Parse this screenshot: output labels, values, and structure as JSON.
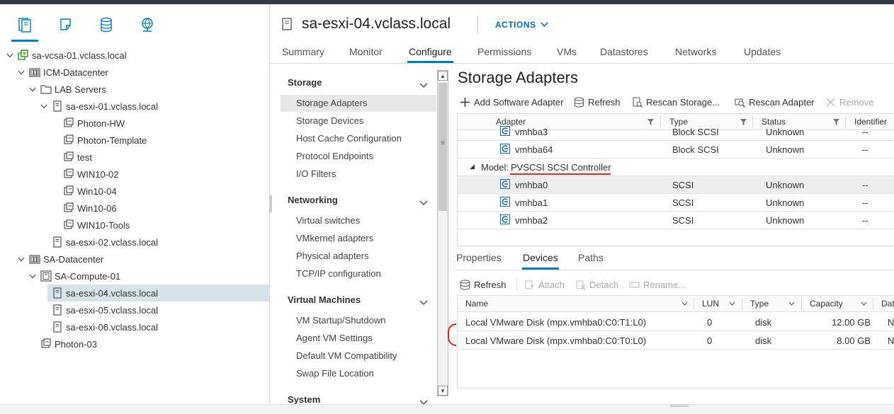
{
  "nav": {
    "icons": [
      "hosts-and-clusters-icon",
      "vms-and-templates-icon",
      "storage-icon",
      "networking-icon"
    ]
  },
  "tree": [
    {
      "label": "sa-vcsa-01.vclass.local",
      "type": "vcenter"
    },
    {
      "label": "ICM-Datacenter",
      "type": "datacenter"
    },
    {
      "label": "LAB Servers",
      "type": "folder"
    },
    {
      "label": "sa-esxi-01.vclass.local",
      "type": "host"
    },
    {
      "label": "Photon-HW",
      "type": "vm"
    },
    {
      "label": "Photon-Template",
      "type": "vm"
    },
    {
      "label": "test",
      "type": "vm"
    },
    {
      "label": "WIN10-02",
      "type": "vm"
    },
    {
      "label": "Win10-04",
      "type": "vm"
    },
    {
      "label": "Win10-06",
      "type": "vm"
    },
    {
      "label": "WIN10-Tools",
      "type": "vm"
    },
    {
      "label": "sa-esxi-02.vclass.local",
      "type": "host"
    },
    {
      "label": "SA-Datacenter",
      "type": "datacenter"
    },
    {
      "label": "SA-Compute-01",
      "type": "cluster"
    },
    {
      "label": "sa-esxi-04.vclass.local",
      "type": "host",
      "selected": true
    },
    {
      "label": "sa-esxi-05.vclass.local",
      "type": "host"
    },
    {
      "label": "sa-esxi-06.vclass.local",
      "type": "host"
    },
    {
      "label": "Photon-03",
      "type": "vm"
    }
  ],
  "header": {
    "title": "sa-esxi-04.vclass.local",
    "actions": "ACTIONS"
  },
  "tabs": [
    "Summary",
    "Monitor",
    "Configure",
    "Permissions",
    "VMs",
    "Datastores",
    "Networks",
    "Updates"
  ],
  "active_tab": "Configure",
  "menu": {
    "sections": [
      {
        "title": "Storage",
        "items": [
          "Storage Adapters",
          "Storage Devices",
          "Host Cache Configuration",
          "Protocol Endpoints",
          "I/O Filters"
        ]
      },
      {
        "title": "Networking",
        "items": [
          "Virtual switches",
          "VMkernel adapters",
          "Physical adapters",
          "TCP/IP configuration"
        ]
      },
      {
        "title": "Virtual Machines",
        "items": [
          "VM Startup/Shutdown",
          "Agent VM Settings",
          "Default VM Compatibility",
          "Swap File Location"
        ]
      },
      {
        "title": "System",
        "items": []
      }
    ],
    "selected": "Storage Adapters"
  },
  "main": {
    "title": "Storage Adapters",
    "toolbar": {
      "add": "Add Software Adapter",
      "refresh": "Refresh",
      "rescan_storage": "Rescan Storage...",
      "rescan_adapter": "Rescan Adapter",
      "remove": "Remove"
    },
    "adapters": {
      "columns": [
        "Adapter",
        "Type",
        "Status",
        "Identifier"
      ],
      "rows_top": [
        {
          "adapter": "vmhba3",
          "type": "Block SCSI",
          "status": "Unknown",
          "identifier": "--"
        },
        {
          "adapter": "vmhba64",
          "type": "Block SCSI",
          "status": "Unknown",
          "identifier": "--"
        }
      ],
      "group_label": "Model:",
      "group_value": "PVSCSI SCSI Controller",
      "rows_group": [
        {
          "adapter": "vmhba0",
          "type": "SCSI",
          "status": "Unknown",
          "identifier": "--",
          "selected": true
        },
        {
          "adapter": "vmhba1",
          "type": "SCSI",
          "status": "Unknown",
          "identifier": "--"
        },
        {
          "adapter": "vmhba2",
          "type": "SCSI",
          "status": "Unknown",
          "identifier": "--"
        }
      ]
    },
    "detail_tabs": [
      "Properties",
      "Devices",
      "Paths"
    ],
    "active_detail_tab": "Devices",
    "devices_toolbar": {
      "refresh": "Refresh",
      "attach": "Attach",
      "detach": "Detach",
      "rename": "Rename..."
    },
    "devices": {
      "columns": [
        "Name",
        "LUN",
        "Type",
        "Capacity",
        "Dat"
      ],
      "rows": [
        {
          "name": "Local VMware Disk (mpx.vmhba0:C0:T1:L0)",
          "lun": "0",
          "type": "disk",
          "capacity": "12.00 GB",
          "dat": "N"
        },
        {
          "name": "Local VMware Disk (mpx.vmhba0:C0:T0:L0)",
          "lun": "0",
          "type": "disk",
          "capacity": "8.00 GB",
          "dat": "N"
        }
      ]
    }
  },
  "colors": {
    "accent": "#0079b8",
    "annotation": "#d9262a",
    "selected_row": "#d8e3e9"
  }
}
